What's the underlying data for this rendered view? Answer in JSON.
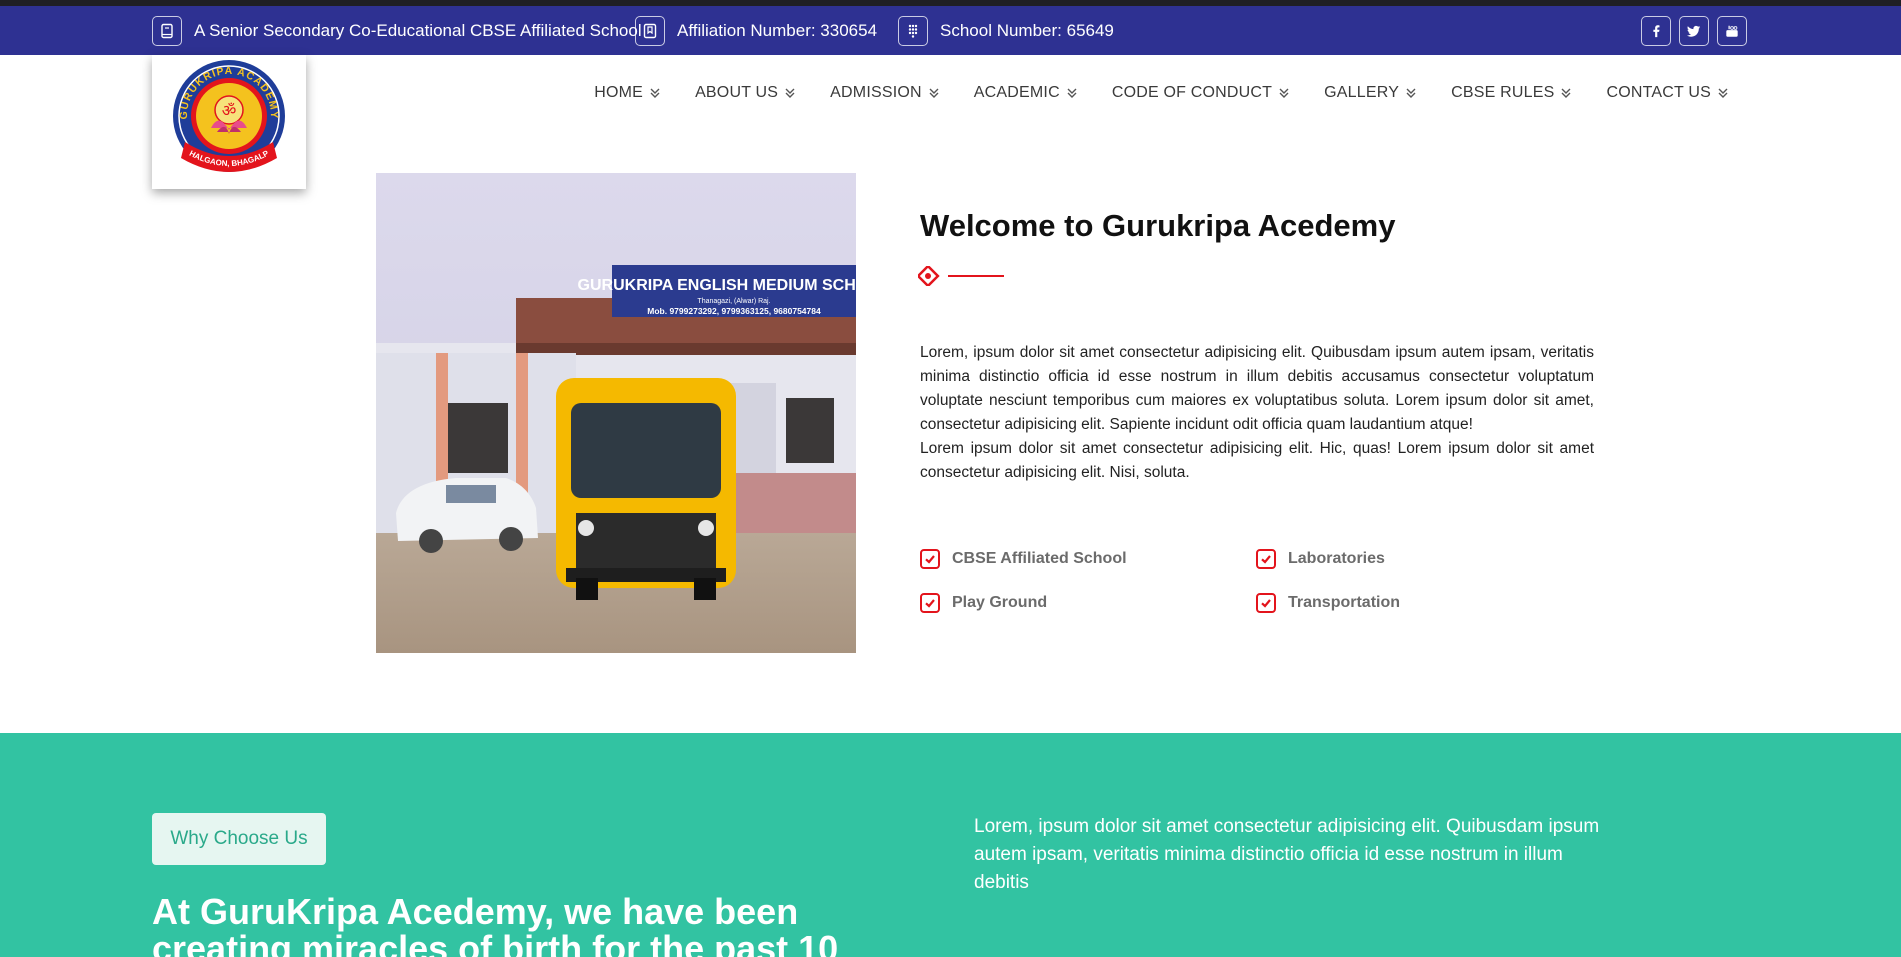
{
  "info_bar": {
    "tagline": "A Senior Secondary Co-Educational CBSE Affiliated School",
    "affiliation": "Affiliation Number: 330654",
    "school_number": "School Number: 65649",
    "tagline_icon": "book-icon",
    "affiliation_icon": "bookmark-icon",
    "school_number_icon": "dial-grid-icon",
    "social": [
      "facebook-icon",
      "twitter-icon",
      "youtube-icon"
    ]
  },
  "logo": {
    "name": "GURUKRIPA ACADEMY",
    "location": "KAHALGAON, BHAGALPUR",
    "symbol": "ॐ"
  },
  "nav": {
    "items": [
      {
        "label": "HOME"
      },
      {
        "label": "ABOUT US"
      },
      {
        "label": "ADMISSION"
      },
      {
        "label": "ACADEMIC"
      },
      {
        "label": "CODE OF CONDUCT"
      },
      {
        "label": "GALLERY"
      },
      {
        "label": "CBSE RULES"
      },
      {
        "label": "CONTACT US"
      }
    ]
  },
  "hero": {
    "sign_text": "GURUKRIPA ENGLISH MEDIUM SCHOOL",
    "sign_sub": "Thanagazi, (Alwar) Raj.",
    "sign_phone": "Mob. 9799273292, 9799363125, 9680754784"
  },
  "welcome": {
    "title": "Welcome to Gurukripa Acedemy",
    "para1": "Lorem, ipsum dolor sit amet consectetur adipisicing elit. Quibusdam ipsum autem ipsam, veritatis minima distinctio officia id esse nostrum in illum debitis accusamus consectetur voluptatum voluptate nesciunt temporibus cum maiores ex voluptatibus soluta. Lorem ipsum dolor sit amet, consectetur adipisicing elit. Sapiente incidunt odit officia quam laudantium atque!",
    "para2": "Lorem ipsum dolor sit amet consectetur adipisicing elit. Hic, quas! Lorem ipsum dolor sit amet consectetur adipisicing elit. Nisi, soluta.",
    "features": [
      "CBSE Affiliated School",
      "Laboratories",
      "Play Ground",
      "Transportation"
    ]
  },
  "why": {
    "badge": "Why Choose Us",
    "title": "At GuruKripa Acedemy, we have been creating miracles of birth for the past 10",
    "para": "Lorem, ipsum dolor sit amet consectetur adipisicing elit. Quibusdam ipsum autem ipsam, veritatis minima distinctio officia id esse nostrum in illum debitis"
  },
  "colors": {
    "info_bar": "#2e3192",
    "accent_red": "#e3141c",
    "teal": "#32c3a2"
  }
}
